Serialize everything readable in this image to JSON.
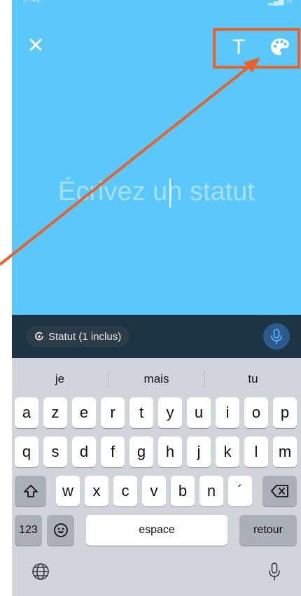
{
  "header": {
    "close_icon": "close-icon",
    "text_tool_label": "T",
    "palette_icon": "palette-icon"
  },
  "composer": {
    "placeholder": "Écrivez un statut",
    "background_color": "#5ac8fa"
  },
  "toolbar": {
    "chip_label": "Statut (1 inclus)",
    "mic_icon": "microphone-icon"
  },
  "keyboard": {
    "suggestions": [
      "je",
      "mais",
      "tu"
    ],
    "row1": [
      "a",
      "z",
      "e",
      "r",
      "t",
      "y",
      "u",
      "i",
      "o",
      "p"
    ],
    "row2": [
      "q",
      "s",
      "d",
      "f",
      "g",
      "h",
      "j",
      "k",
      "l",
      "m"
    ],
    "row3": [
      "w",
      "x",
      "c",
      "v",
      "b",
      "n",
      "´"
    ],
    "numbers_label": "123",
    "space_label": "espace",
    "return_label": "retour"
  },
  "annotation": {
    "color": "#e8622a"
  }
}
